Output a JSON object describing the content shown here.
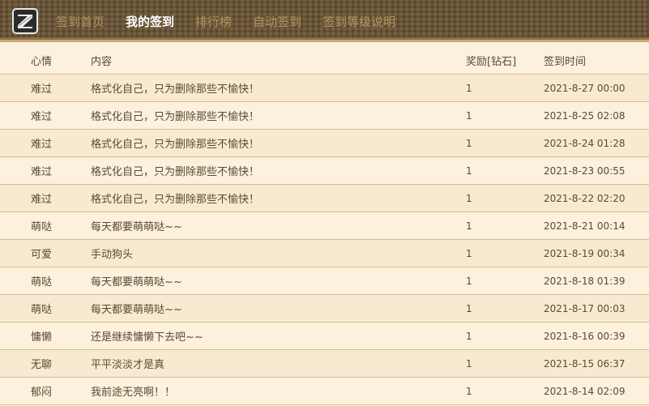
{
  "nav": {
    "items": [
      {
        "label": "签到首页",
        "active": false
      },
      {
        "label": "我的签到",
        "active": true
      },
      {
        "label": "排行榜",
        "active": false
      },
      {
        "label": "自动签到",
        "active": false
      },
      {
        "label": "签到等级说明",
        "active": false
      }
    ]
  },
  "table": {
    "headers": {
      "mood": "心情",
      "content": "内容",
      "reward": "奖励[钻石]",
      "time": "签到时间"
    },
    "rows": [
      {
        "mood": "难过",
        "content": "格式化自己，只为删除那些不愉快！",
        "reward": "1",
        "time": "2021-8-27 00:00"
      },
      {
        "mood": "难过",
        "content": "格式化自己，只为删除那些不愉快！",
        "reward": "1",
        "time": "2021-8-25 02:08"
      },
      {
        "mood": "难过",
        "content": "格式化自己，只为删除那些不愉快！",
        "reward": "1",
        "time": "2021-8-24 01:28"
      },
      {
        "mood": "难过",
        "content": "格式化自己，只为删除那些不愉快！",
        "reward": "1",
        "time": "2021-8-23 00:55"
      },
      {
        "mood": "难过",
        "content": "格式化自己，只为删除那些不愉快！",
        "reward": "1",
        "time": "2021-8-22 02:20"
      },
      {
        "mood": "萌哒",
        "content": "每天都要萌萌哒~~",
        "reward": "1",
        "time": "2021-8-21 00:14"
      },
      {
        "mood": "可爱",
        "content": "手动狗头",
        "reward": "1",
        "time": "2021-8-19 00:34"
      },
      {
        "mood": "萌哒",
        "content": "每天都要萌萌哒~~",
        "reward": "1",
        "time": "2021-8-18 01:39"
      },
      {
        "mood": "萌哒",
        "content": "每天都要萌萌哒~~",
        "reward": "1",
        "time": "2021-8-17 00:03"
      },
      {
        "mood": "慵懒",
        "content": "还是继续慵懒下去吧~~",
        "reward": "1",
        "time": "2021-8-16 00:39"
      },
      {
        "mood": "无聊",
        "content": "平平淡淡才是真",
        "reward": "1",
        "time": "2021-8-15 06:37"
      },
      {
        "mood": "郁闷",
        "content": "我前途无亮啊！！",
        "reward": "1",
        "time": "2021-8-14 02:09"
      }
    ]
  },
  "icons": {
    "logo": "site-logo-icon"
  },
  "colors": {
    "nav_active": "#ffffff",
    "nav_inactive": "#b59765",
    "row_border": "#d8bb8d",
    "background": "#fbf1dc"
  }
}
